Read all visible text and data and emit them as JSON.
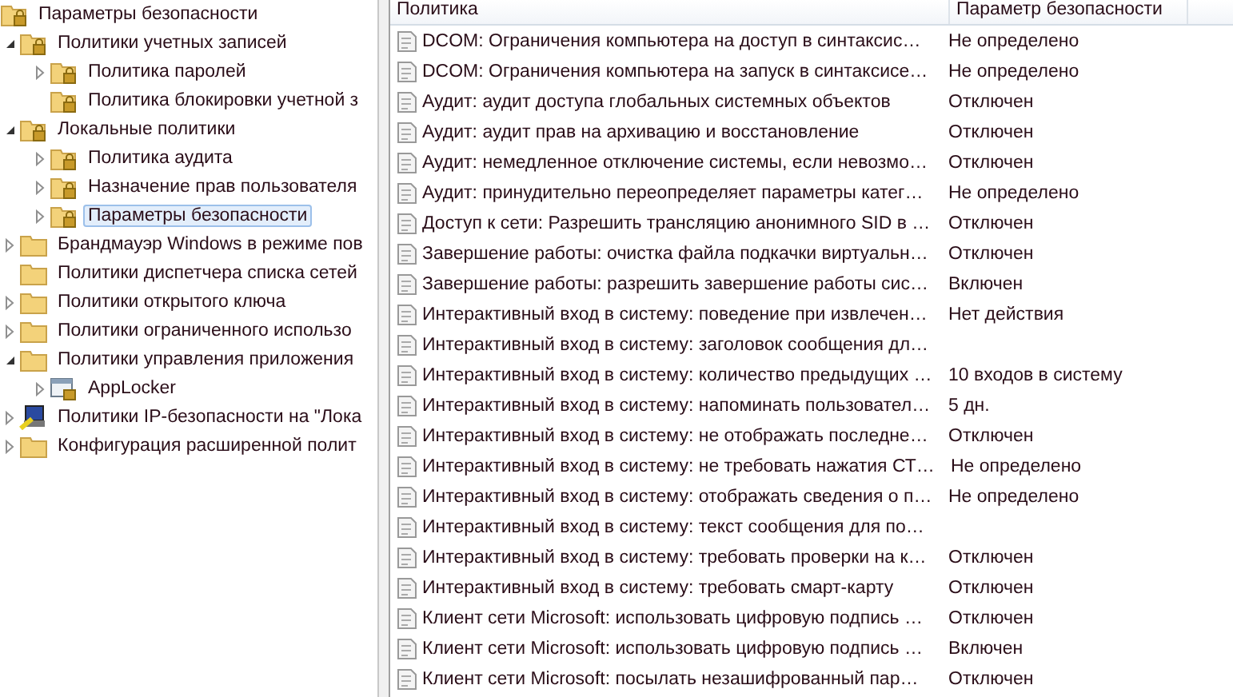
{
  "tree": [
    {
      "label": "Параметры безопасности",
      "kind": "lock-folder",
      "children": [
        {
          "label": "Политики учетных записей",
          "kind": "lock-folder",
          "expanded": true,
          "children": [
            {
              "label": "Политика паролей",
              "kind": "lock-folder",
              "expanded": false,
              "selected": false
            },
            {
              "label": "Политика блокировки учетной з",
              "kind": "lock-folder",
              "selected": false
            }
          ],
          "selected": false
        },
        {
          "label": "Локальные политики",
          "kind": "lock-folder",
          "expanded": true,
          "children": [
            {
              "label": "Политика аудита",
              "kind": "lock-folder",
              "expanded": false,
              "selected": false
            },
            {
              "label": "Назначение прав пользователя",
              "kind": "lock-folder",
              "expanded": false,
              "selected": false
            },
            {
              "label": "Параметры безопасности",
              "kind": "lock-folder",
              "expanded": false,
              "selected": true
            }
          ],
          "selected": false
        },
        {
          "label": "Брандмауэр Windows в режиме пов",
          "kind": "folder",
          "expanded": false,
          "selected": false
        },
        {
          "label": "Политики диспетчера списка сетей",
          "kind": "folder",
          "selected": false
        },
        {
          "label": "Политики открытого ключа",
          "kind": "folder",
          "expanded": false,
          "selected": false
        },
        {
          "label": "Политики ограниченного использо",
          "kind": "folder",
          "expanded": false,
          "selected": false
        },
        {
          "label": "Политики управления приложения",
          "kind": "folder",
          "expanded": true,
          "children": [
            {
              "label": "AppLocker",
              "kind": "applocker",
              "expanded": false,
              "selected": false
            }
          ],
          "selected": false
        },
        {
          "label": "Политики IP-безопасности на \"Лока",
          "kind": "ip-security",
          "expanded": false,
          "selected": false
        },
        {
          "label": "Конфигурация расширенной полит",
          "kind": "folder",
          "expanded": false,
          "selected": false
        }
      ],
      "selected": false
    }
  ],
  "table": {
    "columns": [
      "Политика",
      "Параметр безопасности"
    ],
    "rows": [
      {
        "policy": "DCOM: Ограничения компьютера на доступ в синтаксис…",
        "setting": "Не определено"
      },
      {
        "policy": "DCOM: Ограничения компьютера на запуск в синтаксисе…",
        "setting": "Не определено"
      },
      {
        "policy": "Аудит: аудит доступа глобальных системных объектов",
        "setting": "Отключен"
      },
      {
        "policy": "Аудит: аудит прав на архивацию и восстановление",
        "setting": "Отключен"
      },
      {
        "policy": "Аудит: немедленное отключение системы, если невозмо…",
        "setting": "Отключен"
      },
      {
        "policy": "Аудит: принудительно переопределяет параметры катег…",
        "setting": "Не определено"
      },
      {
        "policy": "Доступ к сети: Разрешить трансляцию анонимного SID в …",
        "setting": "Отключен"
      },
      {
        "policy": "Завершение работы: очистка файла подкачки виртуальн…",
        "setting": "Отключен"
      },
      {
        "policy": "Завершение работы: разрешить завершение работы сис…",
        "setting": "Включен"
      },
      {
        "policy": "Интерактивный вход в систему:  поведение при извлечен…",
        "setting": "Нет действия"
      },
      {
        "policy": "Интерактивный вход в систему: заголовок сообщения дл…"
      },
      {
        "policy": "Интерактивный вход в систему: количество предыдущих …",
        "setting": "10 входов в систему"
      },
      {
        "policy": "Интерактивный вход в систему: напоминать пользовател…",
        "setting": "5 дн."
      },
      {
        "policy": "Интерактивный вход в систему: не отображать последне…",
        "setting": "Отключен"
      },
      {
        "policy": "Интерактивный вход в систему: не требовать нажатия СТ…",
        "setting": "Не определено"
      },
      {
        "policy": "Интерактивный вход в систему: отображать сведения о п…",
        "setting": "Не определено"
      },
      {
        "policy": "Интерактивный вход в систему: текст сообщения для по…"
      },
      {
        "policy": "Интерактивный вход в систему: требовать проверки на к…",
        "setting": "Отключен"
      },
      {
        "policy": "Интерактивный вход в систему: требовать смарт-карту",
        "setting": "Отключен"
      },
      {
        "policy": "Клиент сети Microsoft: использовать цифровую подпись …",
        "setting": "Отключен"
      },
      {
        "policy": "Клиент сети Microsoft: использовать цифровую подпись …",
        "setting": "Включен"
      },
      {
        "policy": "Клиент сети Microsoft: посылать незашифрованный пар…",
        "setting": "Отключен"
      }
    ]
  }
}
